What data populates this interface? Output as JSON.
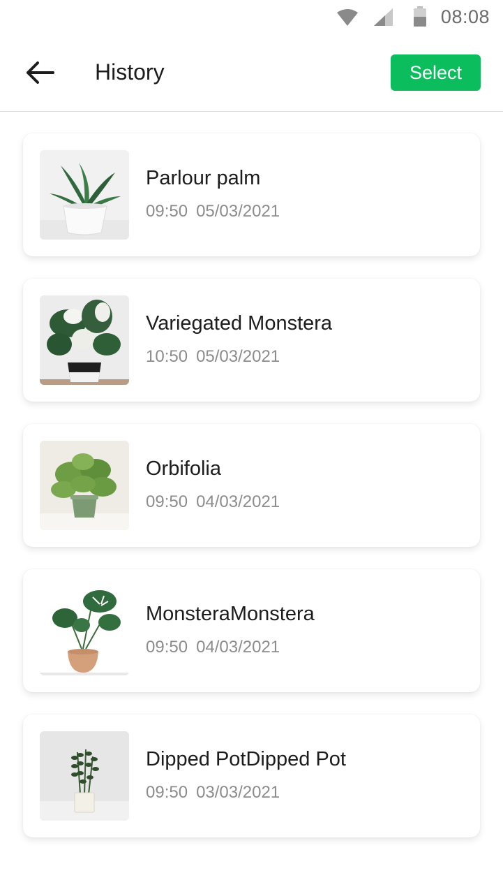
{
  "status_bar": {
    "time": "08:08",
    "icons": [
      "wifi-icon",
      "cellular-signal-icon",
      "battery-icon"
    ]
  },
  "header": {
    "back_icon": "arrow-left-icon",
    "title": "History",
    "select_label": "Select"
  },
  "colors": {
    "accent": "#0bbd5c",
    "title_text": "#1c1c1e",
    "meta_text": "#8c8c8c"
  },
  "history": [
    {
      "name": "Parlour palm",
      "time": "09:50",
      "date": "05/03/2021",
      "image": "parlour-palm-photo"
    },
    {
      "name": "Variegated Monstera",
      "time": "10:50",
      "date": "05/03/2021",
      "image": "variegated-monstera-photo"
    },
    {
      "name": "Orbifolia",
      "time": "09:50",
      "date": "04/03/2021",
      "image": "orbifolia-photo"
    },
    {
      "name": "MonsteraMonstera",
      "time": "09:50",
      "date": "04/03/2021",
      "image": "monstera-photo"
    },
    {
      "name": "Dipped PotDipped Pot",
      "time": "09:50",
      "date": "03/03/2021",
      "image": "dipped-pot-photo"
    }
  ]
}
